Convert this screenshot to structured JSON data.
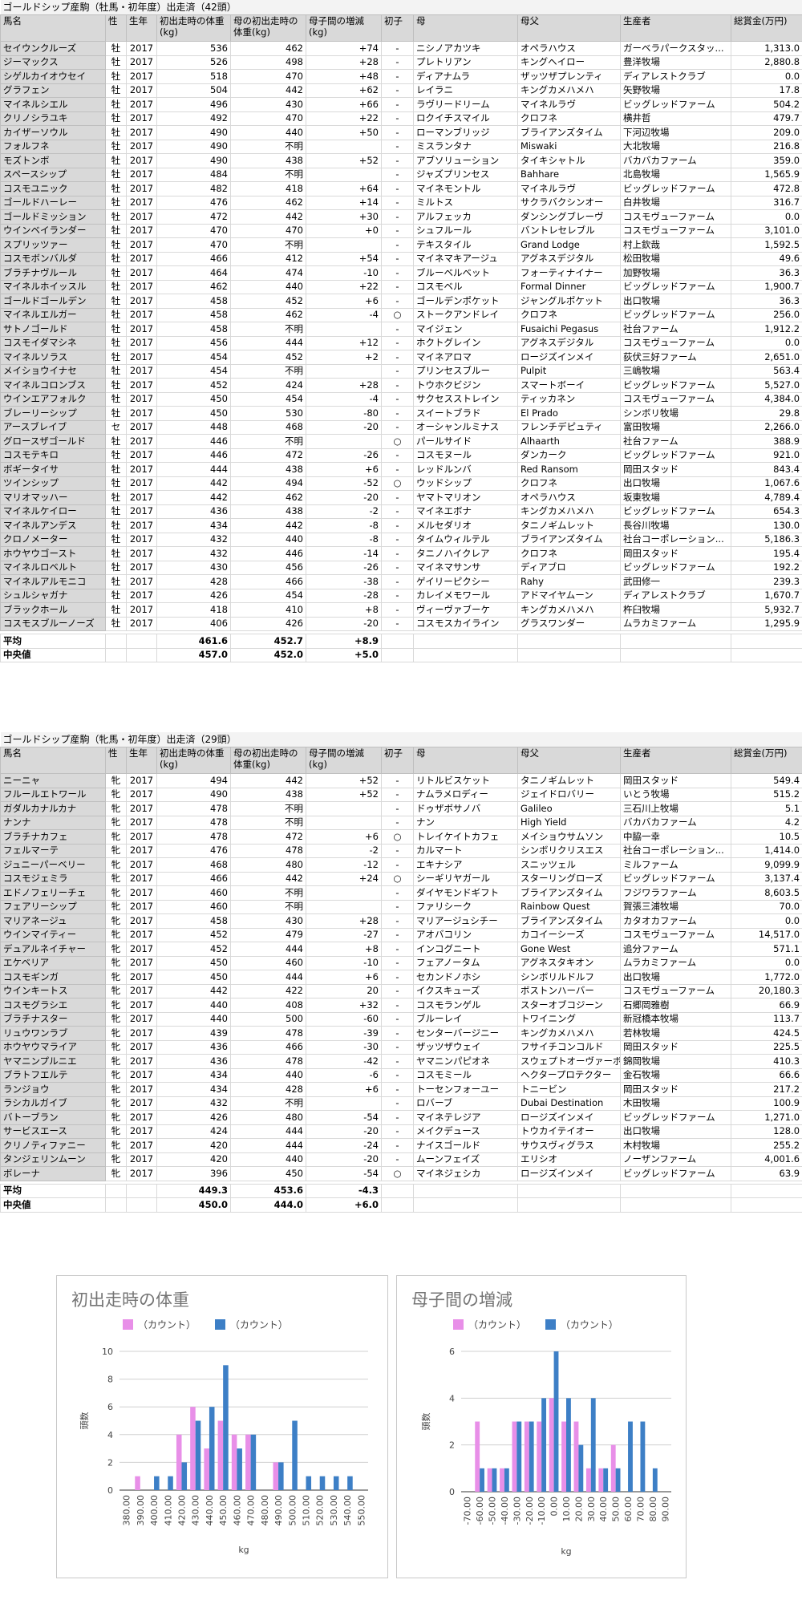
{
  "colors": {
    "pink": "#e88fe8",
    "blue": "#3d7fc6",
    "header_bg": "#d9d9d9"
  },
  "headers": [
    "馬名",
    "性",
    "生年",
    "初出走時の体重(kg)",
    "母の初出走時の体重(kg)",
    "母子間の増減(kg)",
    "初子",
    "母",
    "母父",
    "生産者",
    "総賞金(万円)"
  ],
  "male": {
    "title": "ゴールドシップ産駒（牡馬・初年度）出走済（42頭）",
    "rows": [
      [
        "セイウンクルーズ",
        "牡",
        "2017",
        "536",
        "462",
        "+74",
        "-",
        "ニシノアカツキ",
        "オペラハウス",
        "ガーベラパークスタッ...",
        "1,313.0"
      ],
      [
        "ジーマックス",
        "牡",
        "2017",
        "526",
        "498",
        "+28",
        "-",
        "プレトリアン",
        "キングヘイロー",
        "豊洋牧場",
        "2,880.8"
      ],
      [
        "シゲルカイオウセイ",
        "牡",
        "2017",
        "518",
        "470",
        "+48",
        "-",
        "ディアナムラ",
        "ザッツザプレンティ",
        "ディアレストクラブ",
        "0.0"
      ],
      [
        "グラフェン",
        "牡",
        "2017",
        "504",
        "442",
        "+62",
        "-",
        "レイラニ",
        "キングカメハメハ",
        "矢野牧場",
        "17.8"
      ],
      [
        "マイネルシエル",
        "牡",
        "2017",
        "496",
        "430",
        "+66",
        "-",
        "ラヴリードリーム",
        "マイネルラヴ",
        "ビッグレッドファーム",
        "504.2"
      ],
      [
        "クリノシラユキ",
        "牡",
        "2017",
        "492",
        "470",
        "+22",
        "-",
        "ロクイチスマイル",
        "クロフネ",
        "横井哲",
        "479.7"
      ],
      [
        "カイザーソウル",
        "牡",
        "2017",
        "490",
        "440",
        "+50",
        "-",
        "ローマンブリッジ",
        "ブライアンズタイム",
        "下河辺牧場",
        "209.0"
      ],
      [
        "フォルフネ",
        "牡",
        "2017",
        "490",
        "不明",
        "",
        "-",
        "ミスランタナ",
        "Miswaki",
        "大北牧場",
        "216.8"
      ],
      [
        "モズトンボ",
        "牡",
        "2017",
        "490",
        "438",
        "+52",
        "-",
        "アブソリューション",
        "タイキシャトル",
        "バカバカファーム",
        "359.0"
      ],
      [
        "スペースシップ",
        "牡",
        "2017",
        "484",
        "不明",
        "",
        "-",
        "ジャズプリンセス",
        "Bahhare",
        "北島牧場",
        "1,565.9"
      ],
      [
        "コスモユニック",
        "牡",
        "2017",
        "482",
        "418",
        "+64",
        "-",
        "マイネモントル",
        "マイネルラヴ",
        "ビッグレッドファーム",
        "472.8"
      ],
      [
        "ゴールドハーレー",
        "牡",
        "2017",
        "476",
        "462",
        "+14",
        "-",
        "ミルトス",
        "サクラバクシンオー",
        "白井牧場",
        "316.7"
      ],
      [
        "ゴールドミッション",
        "牡",
        "2017",
        "472",
        "442",
        "+30",
        "-",
        "アルフェッカ",
        "ダンシングブレーヴ",
        "コスモヴューファーム",
        "0.0"
      ],
      [
        "ウインベイランダー",
        "牡",
        "2017",
        "470",
        "470",
        "+0",
        "-",
        "シュフルール",
        "バントレセレブル",
        "コスモヴューファーム",
        "3,101.0"
      ],
      [
        "スプリッツァー",
        "牡",
        "2017",
        "470",
        "不明",
        "",
        "-",
        "テキスタイル",
        "Grand Lodge",
        "村上欽哉",
        "1,592.5"
      ],
      [
        "コスモボンバルダ",
        "牡",
        "2017",
        "466",
        "412",
        "+54",
        "-",
        "マイネマキアージュ",
        "アグネスデジタル",
        "松田牧場",
        "49.6"
      ],
      [
        "ブラチナヴルール",
        "牡",
        "2017",
        "464",
        "474",
        "-10",
        "-",
        "ブルーベルベット",
        "フォーティナイナー",
        "加野牧場",
        "36.3"
      ],
      [
        "マイネルホイッスル",
        "牡",
        "2017",
        "462",
        "440",
        "+22",
        "-",
        "コスモベル",
        "Formal Dinner",
        "ビッグレッドファーム",
        "1,900.7"
      ],
      [
        "ゴールドゴールデン",
        "牡",
        "2017",
        "458",
        "452",
        "+6",
        "-",
        "ゴールデンポケット",
        "ジャングルポケット",
        "出口牧場",
        "36.3"
      ],
      [
        "マイネルエルガー",
        "牡",
        "2017",
        "458",
        "462",
        "-4",
        "○",
        "ストークアンドレイ",
        "クロフネ",
        "ビッグレッドファーム",
        "256.0"
      ],
      [
        "サトノゴールド",
        "牡",
        "2017",
        "458",
        "不明",
        "",
        "-",
        "マイジェン",
        "Fusaichi Pegasus",
        "社台ファーム",
        "1,912.2"
      ],
      [
        "コスモイダマシネ",
        "牡",
        "2017",
        "456",
        "444",
        "+12",
        "-",
        "ホクトグレイン",
        "アグネスデジタル",
        "コスモヴューファーム",
        "0.0"
      ],
      [
        "マイネルソラス",
        "牡",
        "2017",
        "454",
        "452",
        "+2",
        "-",
        "マイネアロマ",
        "ロージズインメイ",
        "荻伏三好ファーム",
        "2,651.0"
      ],
      [
        "メイショウイナセ",
        "牡",
        "2017",
        "454",
        "不明",
        "",
        "-",
        "プリンセスブルー",
        "Pulpit",
        "三嶋牧場",
        "563.4"
      ],
      [
        "マイネルコロンブス",
        "牡",
        "2017",
        "452",
        "424",
        "+28",
        "-",
        "トウホクビジン",
        "スマートボーイ",
        "ビッグレッドファーム",
        "5,527.0"
      ],
      [
        "ウインエアフォルク",
        "牡",
        "2017",
        "450",
        "454",
        "-4",
        "-",
        "サクセスストレイン",
        "ティッカネン",
        "コスモヴューファーム",
        "4,384.0"
      ],
      [
        "ブレーリーシップ",
        "牡",
        "2017",
        "450",
        "530",
        "-80",
        "-",
        "スイートブラド",
        "El Prado",
        "シンボリ牧場",
        "29.8"
      ],
      [
        "アースブレイブ",
        "セ",
        "2017",
        "448",
        "468",
        "-20",
        "-",
        "オーシャンルミナス",
        "フレンチデピュティ",
        "富田牧場",
        "2,266.0"
      ],
      [
        "グロースザゴールド",
        "牡",
        "2017",
        "446",
        "不明",
        "",
        "○",
        "パールサイド",
        "Alhaarth",
        "社台ファーム",
        "388.9"
      ],
      [
        "コスモテキロ",
        "牡",
        "2017",
        "446",
        "472",
        "-26",
        "-",
        "コスモヌール",
        "ダンカーク",
        "ビッグレッドファーム",
        "921.0"
      ],
      [
        "ボギータイサ",
        "牡",
        "2017",
        "444",
        "438",
        "+6",
        "-",
        "レッドルンバ",
        "Red Ransom",
        "岡田スタッド",
        "843.4"
      ],
      [
        "ツインシップ",
        "牡",
        "2017",
        "442",
        "494",
        "-52",
        "○",
        "ウッドシップ",
        "クロフネ",
        "出口牧場",
        "1,067.6"
      ],
      [
        "マリオマッハー",
        "牡",
        "2017",
        "442",
        "462",
        "-20",
        "-",
        "ヤマトマリオン",
        "オペラハウス",
        "坂東牧場",
        "4,789.4"
      ],
      [
        "マイネルケイロー",
        "牡",
        "2017",
        "436",
        "438",
        "-2",
        "-",
        "マイネエボナ",
        "キングカメハメハ",
        "ビッグレッドファーム",
        "654.3"
      ],
      [
        "マイネルアンデス",
        "牡",
        "2017",
        "434",
        "442",
        "-8",
        "-",
        "メルセダリオ",
        "タニノギムレット",
        "長谷川牧場",
        "130.0"
      ],
      [
        "クロノメーター",
        "牡",
        "2017",
        "432",
        "440",
        "-8",
        "-",
        "タイムウィルテル",
        "ブライアンズタイム",
        "社台コーポレーション...",
        "5,186.3"
      ],
      [
        "ホウヤウゴースト",
        "牡",
        "2017",
        "432",
        "446",
        "-14",
        "-",
        "タニノハイクレア",
        "クロフネ",
        "岡田スタッド",
        "195.4"
      ],
      [
        "マイネルロベルト",
        "牡",
        "2017",
        "430",
        "456",
        "-26",
        "-",
        "マイネマサンサ",
        "ディアブロ",
        "ビッグレッドファーム",
        "192.2"
      ],
      [
        "マイネルアルモニコ",
        "牡",
        "2017",
        "428",
        "466",
        "-38",
        "-",
        "ゲイリーピクシー",
        "Rahy",
        "武田修一",
        "239.3"
      ],
      [
        "シュルシャガナ",
        "牡",
        "2017",
        "426",
        "454",
        "-28",
        "-",
        "カレイメモワール",
        "アドマイヤムーン",
        "ディアレストクラブ",
        "1,670.7"
      ],
      [
        "ブラックホール",
        "牡",
        "2017",
        "418",
        "410",
        "+8",
        "-",
        "ヴィーヴァブーケ",
        "キングカメハメハ",
        "杵臼牧場",
        "5,932.7"
      ],
      [
        "コスモスブルーノーズ",
        "牡",
        "2017",
        "406",
        "426",
        "-20",
        "-",
        "コスモスカイライン",
        "グラスワンダー",
        "ムラカミファーム",
        "1,295.9"
      ]
    ],
    "avg_label": "平均",
    "avg": [
      "461.6",
      "452.7",
      "+8.9"
    ],
    "median_label": "中央値",
    "median": [
      "457.0",
      "452.0",
      "+5.0"
    ]
  },
  "female": {
    "title": "ゴールドシップ産駒（牝馬・初年度）出走済（29頭）",
    "rows": [
      [
        "ニーニャ",
        "牝",
        "2017",
        "494",
        "442",
        "+52",
        "-",
        "リトルビスケット",
        "タニノギムレット",
        "岡田スタッド",
        "549.4"
      ],
      [
        "フルールエトワール",
        "牝",
        "2017",
        "490",
        "438",
        "+52",
        "-",
        "ナムラメロディー",
        "ジェイドロバリー",
        "いとう牧場",
        "515.2"
      ],
      [
        "ガダルカナルカナ",
        "牝",
        "2017",
        "478",
        "不明",
        "",
        "-",
        "ドゥザボサノバ",
        "Galileo",
        "三石川上牧場",
        "5.1"
      ],
      [
        "ナンナ",
        "牝",
        "2017",
        "478",
        "不明",
        "",
        "-",
        "ナン",
        "High Yield",
        "バカバカファーム",
        "4.2"
      ],
      [
        "ブラチナカフェ",
        "牝",
        "2017",
        "478",
        "472",
        "+6",
        "○",
        "トレイケイトカフェ",
        "メイショウサムソン",
        "中脇一幸",
        "10.5"
      ],
      [
        "フェルマーテ",
        "牝",
        "2017",
        "476",
        "478",
        "-2",
        "-",
        "カルマート",
        "シンボリクリスエス",
        "社台コーポレーション...",
        "1,414.0"
      ],
      [
        "ジュニーパーベリー",
        "牝",
        "2017",
        "468",
        "480",
        "-12",
        "-",
        "エキナシア",
        "スニッツェル",
        "ミルファーム",
        "9,099.9"
      ],
      [
        "コスモジェミラ",
        "牝",
        "2017",
        "466",
        "442",
        "+24",
        "○",
        "シーギリヤガール",
        "スターリングローズ",
        "ビッグレッドファーム",
        "3,137.4"
      ],
      [
        "エドノフェリーチェ",
        "牝",
        "2017",
        "460",
        "不明",
        "",
        "-",
        "ダイヤモンドギフト",
        "ブライアンズタイム",
        "フジワラファーム",
        "8,603.5"
      ],
      [
        "フェアリーシップ",
        "牝",
        "2017",
        "460",
        "不明",
        "",
        "-",
        "ファリシーク",
        "Rainbow Quest",
        "賀張三浦牧場",
        "70.0"
      ],
      [
        "マリアネージュ",
        "牝",
        "2017",
        "458",
        "430",
        "+28",
        "-",
        "マリアージュシチー",
        "ブライアンズタイム",
        "カタオカファーム",
        "0.0"
      ],
      [
        "ウインマイティー",
        "牝",
        "2017",
        "452",
        "479",
        "-27",
        "-",
        "アオバコリン",
        "カコイーシーズ",
        "コスモヴューファーム",
        "14,517.0"
      ],
      [
        "デュアルネイチャー",
        "牝",
        "2017",
        "452",
        "444",
        "+8",
        "-",
        "インコグニート",
        "Gone West",
        "追分ファーム",
        "571.1"
      ],
      [
        "エケベリア",
        "牝",
        "2017",
        "450",
        "460",
        "-10",
        "-",
        "フェアノータム",
        "アグネスタキオン",
        "ムラカミファーム",
        "0.0"
      ],
      [
        "コスモギンガ",
        "牝",
        "2017",
        "450",
        "444",
        "+6",
        "-",
        "セカンドノホシ",
        "シンボリルドルフ",
        "出口牧場",
        "1,772.0"
      ],
      [
        "ウインキートス",
        "牝",
        "2017",
        "442",
        "422",
        "20",
        "-",
        "イクスキューズ",
        "ボストンハーバー",
        "コスモヴューファーム",
        "20,180.3"
      ],
      [
        "コスモグラシエ",
        "牝",
        "2017",
        "440",
        "408",
        "+32",
        "-",
        "コスモランゲル",
        "スターオブコジーン",
        "石郷岡雅樹",
        "66.9"
      ],
      [
        "ブラチナスター",
        "牝",
        "2017",
        "440",
        "500",
        "-60",
        "-",
        "ブルーレイ",
        "トワイニング",
        "新冠橋本牧場",
        "113.7"
      ],
      [
        "リュウワンラブ",
        "牝",
        "2017",
        "439",
        "478",
        "-39",
        "-",
        "センターバージニー",
        "キングカメハメハ",
        "若林牧場",
        "424.5"
      ],
      [
        "ホウヤウマライア",
        "牝",
        "2017",
        "436",
        "466",
        "-30",
        "-",
        "ザッツザウェイ",
        "フサイチコンコルド",
        "岡田スタッド",
        "225.5"
      ],
      [
        "ヤマニンプルニエ",
        "牝",
        "2017",
        "436",
        "478",
        "-42",
        "-",
        "ヤマニンパピオネ",
        "スウェプトオーヴァーボード",
        "錦岡牧場",
        "410.3"
      ],
      [
        "ブラトフエルテ",
        "牝",
        "2017",
        "434",
        "440",
        "-6",
        "-",
        "コスモミール",
        "ヘクタープロテクター",
        "金石牧場",
        "66.6"
      ],
      [
        "ランジョウ",
        "牝",
        "2017",
        "434",
        "428",
        "+6",
        "-",
        "トーセンフォーユー",
        "トニービン",
        "岡田スタッド",
        "217.2"
      ],
      [
        "ラシカルガイブ",
        "牝",
        "2017",
        "432",
        "不明",
        "",
        "-",
        "ロバーブ",
        "Dubai Destination",
        "木田牧場",
        "100.9"
      ],
      [
        "バトーブラン",
        "牝",
        "2017",
        "426",
        "480",
        "-54",
        "-",
        "マイネテレジア",
        "ロージズインメイ",
        "ビッグレッドファーム",
        "1,271.0"
      ],
      [
        "サービスエース",
        "牝",
        "2017",
        "424",
        "444",
        "-20",
        "-",
        "メイクデュース",
        "トウカイテイオー",
        "出口牧場",
        "128.0"
      ],
      [
        "クリノティファニー",
        "牝",
        "2017",
        "420",
        "444",
        "-24",
        "-",
        "ナイスゴールド",
        "サウスヴィグラス",
        "木村牧場",
        "255.2"
      ],
      [
        "タンジェリンムーン",
        "牝",
        "2017",
        "420",
        "440",
        "-20",
        "-",
        "ムーンフェイズ",
        "エリシオ",
        "ノーザンファーム",
        "4,001.6"
      ],
      [
        "ボレーナ",
        "牝",
        "2017",
        "396",
        "450",
        "-54",
        "○",
        "マイネジェシカ",
        "ロージズインメイ",
        "ビッグレッドファーム",
        "63.9"
      ]
    ],
    "avg_label": "平均",
    "avg": [
      "449.3",
      "453.6",
      "-4.3"
    ],
    "median_label": "中央値",
    "median": [
      "450.0",
      "444.0",
      "+6.0"
    ]
  },
  "chart_data": [
    {
      "type": "bar",
      "title": "初出走時の体重",
      "xlabel": "kg",
      "ylabel": "頭数",
      "ylim": [
        0,
        10
      ],
      "yticks": [
        0,
        2,
        4,
        6,
        8,
        10
      ],
      "grid": true,
      "legend": "top",
      "categories": [
        "380.00",
        "390.00",
        "400.00",
        "410.00",
        "420.00",
        "430.00",
        "440.00",
        "450.00",
        "460.00",
        "470.00",
        "480.00",
        "490.00",
        "500.00",
        "510.00",
        "520.00",
        "530.00",
        "540.00",
        "550.00"
      ],
      "series": [
        {
          "name": "（カウント）",
          "color": "#e88fe8",
          "values": [
            0,
            1,
            0,
            0,
            4,
            6,
            3,
            5,
            4,
            4,
            0,
            2,
            0,
            0,
            0,
            0,
            0,
            0
          ]
        },
        {
          "name": "（カウント）",
          "color": "#3d7fc6",
          "values": [
            0,
            0,
            1,
            1,
            2,
            5,
            6,
            9,
            3,
            4,
            0,
            2,
            5,
            1,
            1,
            1,
            1,
            0
          ]
        }
      ]
    },
    {
      "type": "bar",
      "title": "母子間の増減",
      "xlabel": "kg",
      "ylabel": "頭数",
      "ylim": [
        0,
        6
      ],
      "yticks": [
        0,
        2,
        4,
        6
      ],
      "grid": true,
      "legend": "top",
      "categories": [
        "-70.00",
        "-60.00",
        "-50.00",
        "-40.00",
        "-30.00",
        "-20.00",
        "-10.00",
        "0.00",
        "10.00",
        "20.00",
        "30.00",
        "40.00",
        "50.00",
        "60.00",
        "70.00",
        "80.00",
        "90.00"
      ],
      "series": [
        {
          "name": "（カウント）",
          "color": "#e88fe8",
          "values": [
            0,
            3,
            1,
            1,
            3,
            3,
            3,
            4,
            3,
            3,
            1,
            1,
            2,
            0,
            0,
            0,
            0
          ]
        },
        {
          "name": "（カウント）",
          "color": "#3d7fc6",
          "values": [
            0,
            1,
            1,
            1,
            3,
            3,
            4,
            6,
            4,
            2,
            4,
            1,
            1,
            3,
            3,
            1,
            0
          ]
        }
      ]
    }
  ]
}
